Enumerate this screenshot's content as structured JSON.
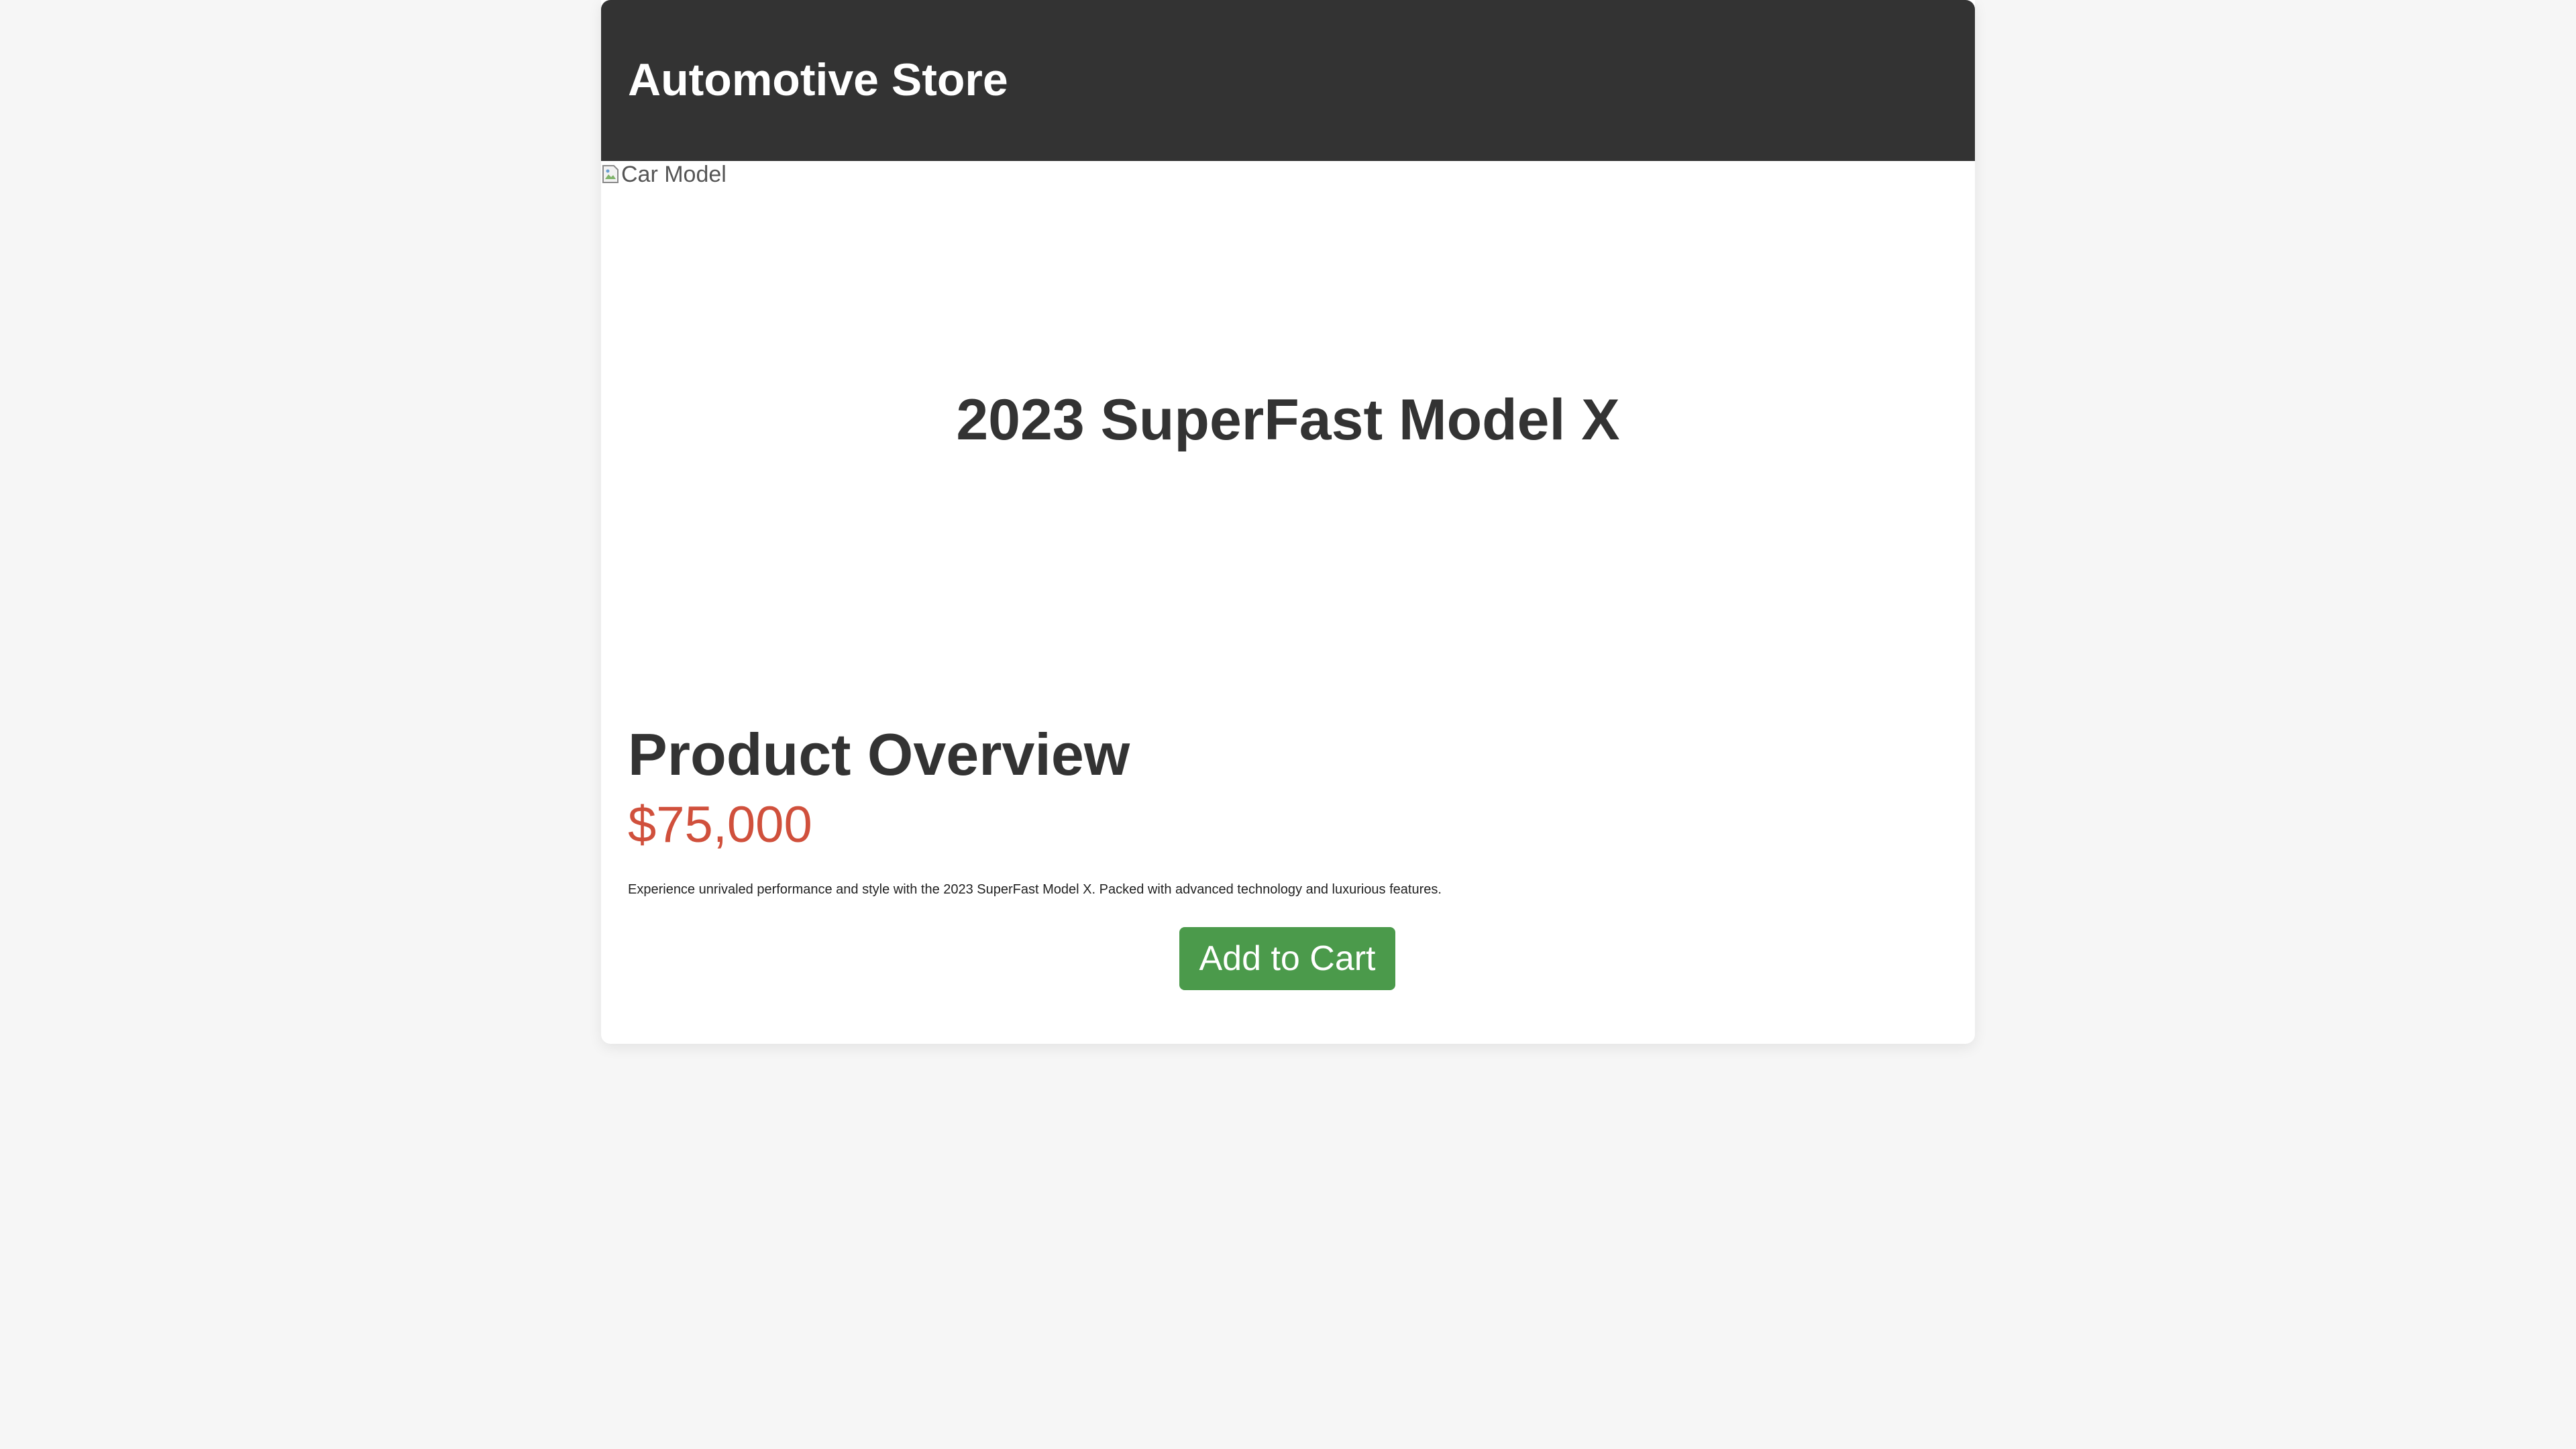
{
  "header": {
    "store_title": "Automotive Store"
  },
  "hero": {
    "image_alt": "Car Model",
    "image_icon": "broken-image-icon",
    "car_title": "2023 SuperFast Model X"
  },
  "product": {
    "overview_title": "Product Overview",
    "price": "$75,000",
    "description": "Experience unrivaled performance and style with the 2023 SuperFast Model X. Packed with advanced technology and luxurious features.",
    "add_to_cart_label": "Add to Cart"
  },
  "colors": {
    "header_bg": "#333333",
    "price": "#d0503c",
    "button_bg": "#4b9a4b",
    "page_bg": "#f6f6f6"
  }
}
